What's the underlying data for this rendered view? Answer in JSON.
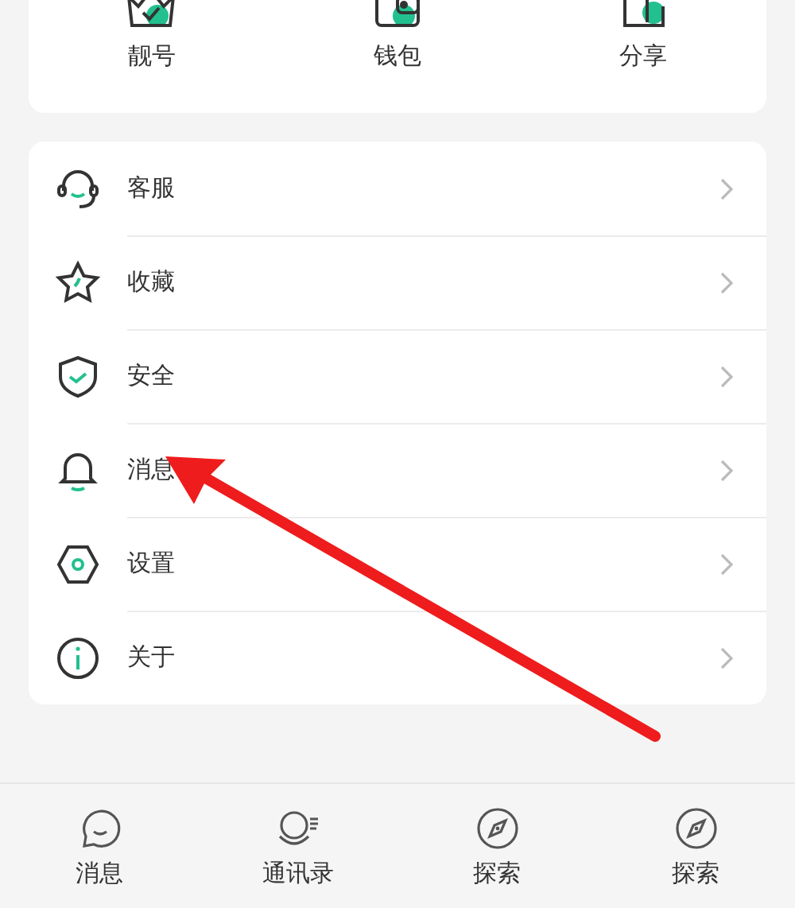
{
  "shortcuts": [
    {
      "label": "靓号",
      "kind": "crown"
    },
    {
      "label": "钱包",
      "kind": "wallet"
    },
    {
      "label": "分享",
      "kind": "share"
    }
  ],
  "menu": [
    {
      "label": "客服",
      "kind": "headset"
    },
    {
      "label": "收藏",
      "kind": "star"
    },
    {
      "label": "安全",
      "kind": "shield"
    },
    {
      "label": "消息",
      "kind": "bell"
    },
    {
      "label": "设置",
      "kind": "hexagon"
    },
    {
      "label": "关于",
      "kind": "info"
    }
  ],
  "bottom_nav": [
    {
      "label": "消息",
      "kind": "chat"
    },
    {
      "label": "通讯录",
      "kind": "contacts"
    },
    {
      "label": "探索",
      "kind": "compass"
    },
    {
      "label": "探索",
      "kind": "compass"
    }
  ],
  "annotation": {
    "kind": "arrow"
  }
}
